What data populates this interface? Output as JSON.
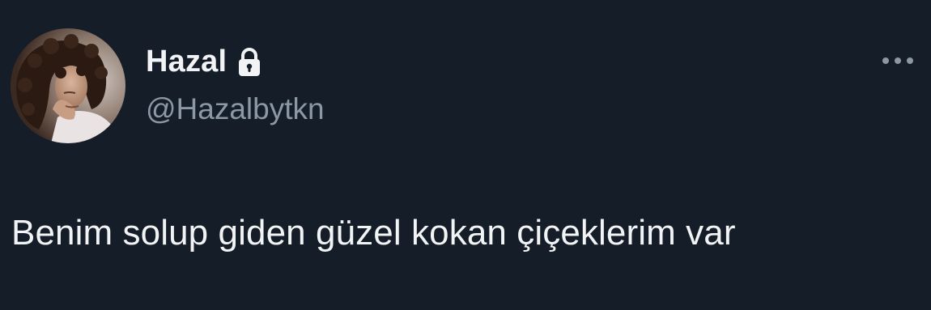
{
  "author": {
    "display_name": "Hazal",
    "handle": "@Hazalbytkn",
    "protected_icon": "lock-icon"
  },
  "tweet": {
    "text": "Benim solup giden güzel kokan çiçeklerim var"
  },
  "actions": {
    "more_icon": "more-horizontal-icon"
  },
  "colors": {
    "background": "#151d28",
    "primary_text": "#f1f3f4",
    "secondary_text": "#8b98a5"
  }
}
